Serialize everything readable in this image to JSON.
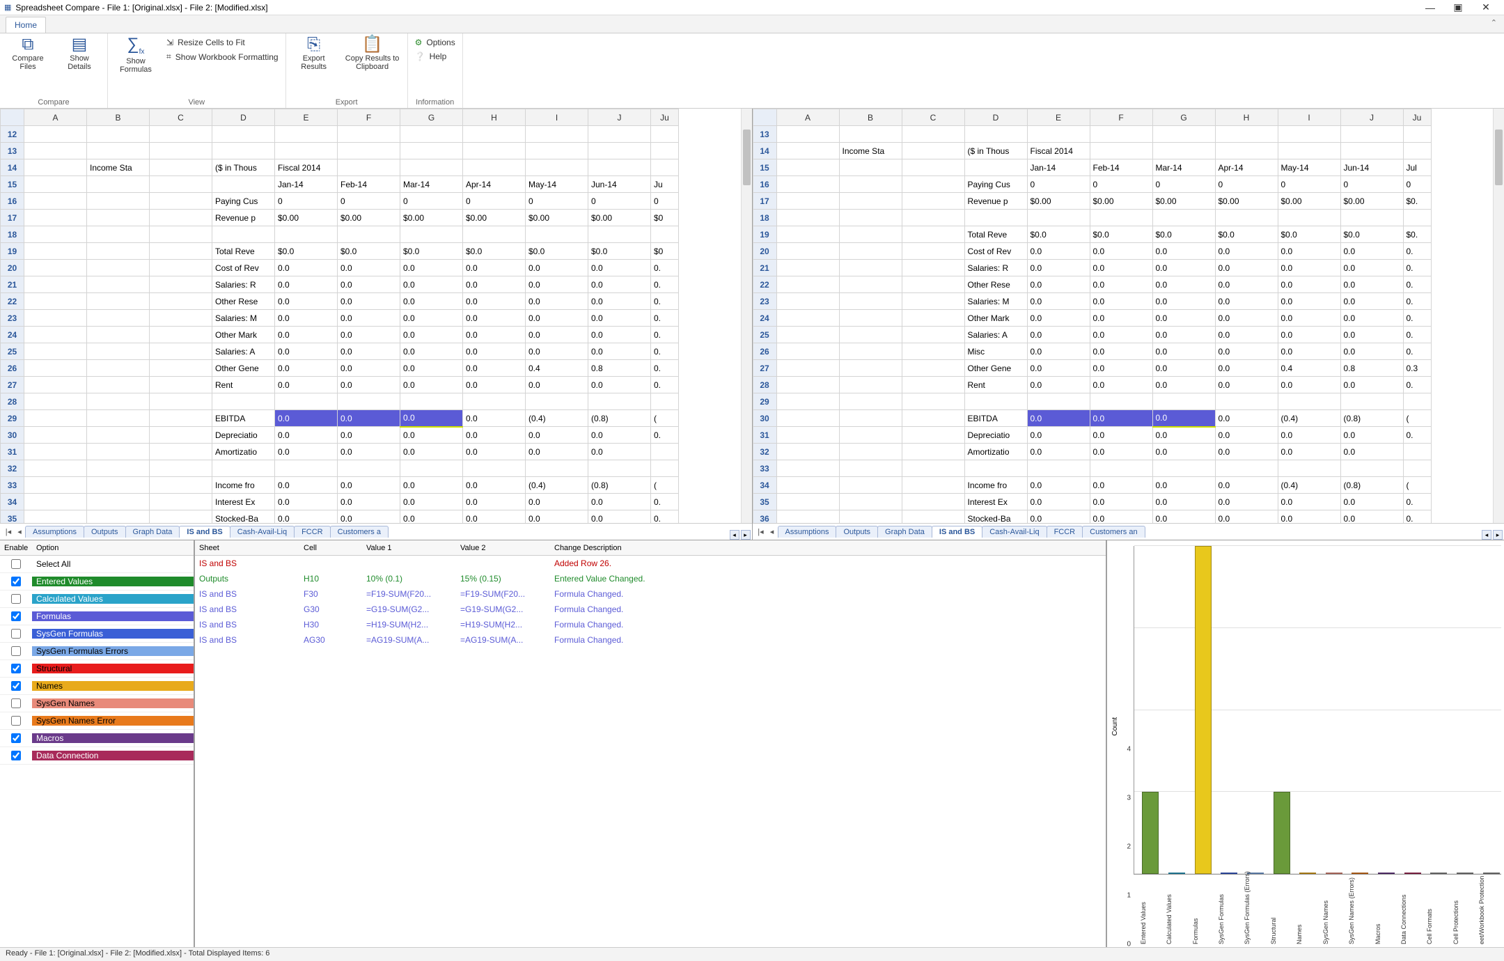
{
  "window": {
    "title": "Spreadsheet Compare - File 1: [Original.xlsx] - File 2: [Modified.xlsx]",
    "min": "—",
    "max": "▣",
    "close": "✕"
  },
  "ribbon": {
    "home_tab": "Home",
    "groups": {
      "compare": {
        "label": "Compare",
        "compare_files": "Compare Files",
        "show_details": "Show Details"
      },
      "view": {
        "label": "View",
        "show_formulas": "Show Formulas",
        "resize": "Resize Cells to Fit",
        "wb_format": "Show Workbook Formatting"
      },
      "export": {
        "label": "Export",
        "export_results": "Export Results",
        "copy_clip": "Copy Results to Clipboard"
      },
      "info": {
        "label": "Information",
        "options": "Options",
        "help": "Help"
      }
    }
  },
  "grid_common": {
    "col_headers": [
      "A",
      "B",
      "C",
      "D",
      "E",
      "F",
      "G",
      "H",
      "I",
      "J",
      "Ju"
    ]
  },
  "grid_left": {
    "row_start": 12,
    "rows": [
      {
        "r": 12,
        "cells": [
          "",
          "",
          "",
          "",
          "",
          "",
          "",
          "",
          "",
          ""
        ]
      },
      {
        "r": 13,
        "cells": [
          "",
          "",
          "",
          "",
          "",
          "",
          "",
          "",
          "",
          ""
        ]
      },
      {
        "r": 14,
        "cells": [
          "",
          "Income Sta",
          "",
          "($ in Thous",
          "Fiscal 2014",
          "",
          "",
          "",
          "",
          ""
        ]
      },
      {
        "r": 15,
        "cells": [
          "",
          "",
          "",
          "",
          "Jan-14",
          "Feb-14",
          "Mar-14",
          "Apr-14",
          "May-14",
          "Jun-14",
          "Ju"
        ]
      },
      {
        "r": 16,
        "cells": [
          "",
          "",
          "",
          "Paying Cus",
          "0",
          "0",
          "0",
          "0",
          "0",
          "0",
          "0"
        ]
      },
      {
        "r": 17,
        "cells": [
          "",
          "",
          "",
          "Revenue p",
          "$0.00",
          "$0.00",
          "$0.00",
          "$0.00",
          "$0.00",
          "$0.00",
          "$0"
        ]
      },
      {
        "r": 18,
        "cells": [
          "",
          "",
          "",
          "",
          "",
          "",
          "",
          "",
          "",
          ""
        ]
      },
      {
        "r": 19,
        "cells": [
          "",
          "",
          "",
          "Total Reve",
          "$0.0",
          "$0.0",
          "$0.0",
          "$0.0",
          "$0.0",
          "$0.0",
          "$0"
        ]
      },
      {
        "r": 20,
        "cells": [
          "",
          "",
          "",
          "Cost of Rev",
          "0.0",
          "0.0",
          "0.0",
          "0.0",
          "0.0",
          "0.0",
          "0."
        ]
      },
      {
        "r": 21,
        "cells": [
          "",
          "",
          "",
          "Salaries: R",
          "0.0",
          "0.0",
          "0.0",
          "0.0",
          "0.0",
          "0.0",
          "0."
        ]
      },
      {
        "r": 22,
        "cells": [
          "",
          "",
          "",
          "Other Rese",
          "0.0",
          "0.0",
          "0.0",
          "0.0",
          "0.0",
          "0.0",
          "0."
        ]
      },
      {
        "r": 23,
        "cells": [
          "",
          "",
          "",
          "Salaries: M",
          "0.0",
          "0.0",
          "0.0",
          "0.0",
          "0.0",
          "0.0",
          "0."
        ]
      },
      {
        "r": 24,
        "cells": [
          "",
          "",
          "",
          "Other Mark",
          "0.0",
          "0.0",
          "0.0",
          "0.0",
          "0.0",
          "0.0",
          "0."
        ]
      },
      {
        "r": 25,
        "cells": [
          "",
          "",
          "",
          "Salaries: A",
          "0.0",
          "0.0",
          "0.0",
          "0.0",
          "0.0",
          "0.0",
          "0."
        ]
      },
      {
        "r": 26,
        "cells": [
          "",
          "",
          "",
          "Other Gene",
          "0.0",
          "0.0",
          "0.0",
          "0.0",
          "0.4",
          "0.8",
          "0."
        ]
      },
      {
        "r": 27,
        "cells": [
          "",
          "",
          "",
          "Rent",
          "0.0",
          "0.0",
          "0.0",
          "0.0",
          "0.0",
          "0.0",
          "0."
        ]
      },
      {
        "r": 28,
        "cells": [
          "",
          "",
          "",
          "",
          "",
          "",
          "",
          "",
          "",
          ""
        ]
      },
      {
        "r": 29,
        "cells": [
          "",
          "",
          "",
          "EBITDA",
          "0.0",
          "0.0",
          "0.0",
          "0.0",
          "(0.4)",
          "(0.8)",
          "("
        ],
        "hl": [
          5,
          6,
          7
        ]
      },
      {
        "r": 30,
        "cells": [
          "",
          "",
          "",
          "Depreciatio",
          "0.0",
          "0.0",
          "0.0",
          "0.0",
          "0.0",
          "0.0",
          "0."
        ]
      },
      {
        "r": 31,
        "cells": [
          "",
          "",
          "",
          "Amortizatio",
          "0.0",
          "0.0",
          "0.0",
          "0.0",
          "0.0",
          "0.0",
          ""
        ]
      },
      {
        "r": 32,
        "cells": [
          "",
          "",
          "",
          "",
          "",
          "",
          "",
          "",
          "",
          ""
        ]
      },
      {
        "r": 33,
        "cells": [
          "",
          "",
          "",
          "Income fro",
          "0.0",
          "0.0",
          "0.0",
          "0.0",
          "(0.4)",
          "(0.8)",
          "("
        ]
      },
      {
        "r": 34,
        "cells": [
          "",
          "",
          "",
          "Interest Ex",
          "0.0",
          "0.0",
          "0.0",
          "0.0",
          "0.0",
          "0.0",
          "0."
        ]
      },
      {
        "r": 35,
        "cells": [
          "",
          "",
          "",
          "Stocked-Ba",
          "0.0",
          "0.0",
          "0.0",
          "0.0",
          "0.0",
          "0.0",
          "0."
        ]
      }
    ],
    "tabs": [
      "Assumptions",
      "Outputs",
      "Graph Data",
      "IS and BS",
      "Cash-Avail-Liq",
      "FCCR",
      "Customers a"
    ],
    "active_tab": "IS and BS"
  },
  "grid_right": {
    "row_start": 13,
    "rows": [
      {
        "r": 13,
        "cells": [
          "",
          "",
          "",
          "",
          "",
          "",
          "",
          "",
          "",
          ""
        ]
      },
      {
        "r": 14,
        "cells": [
          "",
          "Income Sta",
          "",
          "($ in Thous",
          "Fiscal 2014",
          "",
          "",
          "",
          "",
          ""
        ]
      },
      {
        "r": 15,
        "cells": [
          "",
          "",
          "",
          "",
          "Jan-14",
          "Feb-14",
          "Mar-14",
          "Apr-14",
          "May-14",
          "Jun-14",
          "Jul"
        ]
      },
      {
        "r": 16,
        "cells": [
          "",
          "",
          "",
          "Paying Cus",
          "0",
          "0",
          "0",
          "0",
          "0",
          "0",
          "0"
        ]
      },
      {
        "r": 17,
        "cells": [
          "",
          "",
          "",
          "Revenue p",
          "$0.00",
          "$0.00",
          "$0.00",
          "$0.00",
          "$0.00",
          "$0.00",
          "$0."
        ]
      },
      {
        "r": 18,
        "cells": [
          "",
          "",
          "",
          "",
          "",
          "",
          "",
          "",
          "",
          ""
        ]
      },
      {
        "r": 19,
        "cells": [
          "",
          "",
          "",
          "Total Reve",
          "$0.0",
          "$0.0",
          "$0.0",
          "$0.0",
          "$0.0",
          "$0.0",
          "$0."
        ]
      },
      {
        "r": 20,
        "cells": [
          "",
          "",
          "",
          "Cost of Rev",
          "0.0",
          "0.0",
          "0.0",
          "0.0",
          "0.0",
          "0.0",
          "0."
        ]
      },
      {
        "r": 21,
        "cells": [
          "",
          "",
          "",
          "Salaries: R",
          "0.0",
          "0.0",
          "0.0",
          "0.0",
          "0.0",
          "0.0",
          "0."
        ]
      },
      {
        "r": 22,
        "cells": [
          "",
          "",
          "",
          "Other Rese",
          "0.0",
          "0.0",
          "0.0",
          "0.0",
          "0.0",
          "0.0",
          "0."
        ]
      },
      {
        "r": 23,
        "cells": [
          "",
          "",
          "",
          "Salaries: M",
          "0.0",
          "0.0",
          "0.0",
          "0.0",
          "0.0",
          "0.0",
          "0."
        ]
      },
      {
        "r": 24,
        "cells": [
          "",
          "",
          "",
          "Other Mark",
          "0.0",
          "0.0",
          "0.0",
          "0.0",
          "0.0",
          "0.0",
          "0."
        ]
      },
      {
        "r": 25,
        "cells": [
          "",
          "",
          "",
          "Salaries: A",
          "0.0",
          "0.0",
          "0.0",
          "0.0",
          "0.0",
          "0.0",
          "0."
        ]
      },
      {
        "r": 26,
        "cells": [
          "",
          "",
          "",
          "Misc",
          "0.0",
          "0.0",
          "0.0",
          "0.0",
          "0.0",
          "0.0",
          "0."
        ]
      },
      {
        "r": 27,
        "cells": [
          "",
          "",
          "",
          "Other Gene",
          "0.0",
          "0.0",
          "0.0",
          "0.0",
          "0.4",
          "0.8",
          "0.3"
        ]
      },
      {
        "r": 28,
        "cells": [
          "",
          "",
          "",
          "Rent",
          "0.0",
          "0.0",
          "0.0",
          "0.0",
          "0.0",
          "0.0",
          "0."
        ]
      },
      {
        "r": 29,
        "cells": [
          "",
          "",
          "",
          "",
          "",
          "",
          "",
          "",
          "",
          ""
        ]
      },
      {
        "r": 30,
        "cells": [
          "",
          "",
          "",
          "EBITDA",
          "0.0",
          "0.0",
          "0.0",
          "0.0",
          "(0.4)",
          "(0.8)",
          "("
        ],
        "hl": [
          5,
          6,
          7
        ]
      },
      {
        "r": 31,
        "cells": [
          "",
          "",
          "",
          "Depreciatio",
          "0.0",
          "0.0",
          "0.0",
          "0.0",
          "0.0",
          "0.0",
          "0."
        ]
      },
      {
        "r": 32,
        "cells": [
          "",
          "",
          "",
          "Amortizatio",
          "0.0",
          "0.0",
          "0.0",
          "0.0",
          "0.0",
          "0.0",
          ""
        ]
      },
      {
        "r": 33,
        "cells": [
          "",
          "",
          "",
          "",
          "",
          "",
          "",
          "",
          "",
          ""
        ]
      },
      {
        "r": 34,
        "cells": [
          "",
          "",
          "",
          "Income fro",
          "0.0",
          "0.0",
          "0.0",
          "0.0",
          "(0.4)",
          "(0.8)",
          "("
        ]
      },
      {
        "r": 35,
        "cells": [
          "",
          "",
          "",
          "Interest Ex",
          "0.0",
          "0.0",
          "0.0",
          "0.0",
          "0.0",
          "0.0",
          "0."
        ]
      },
      {
        "r": 36,
        "cells": [
          "",
          "",
          "",
          "Stocked-Ba",
          "0.0",
          "0.0",
          "0.0",
          "0.0",
          "0.0",
          "0.0",
          "0."
        ]
      }
    ],
    "tabs": [
      "Assumptions",
      "Outputs",
      "Graph Data",
      "IS and BS",
      "Cash-Avail-Liq",
      "FCCR",
      "Customers an"
    ],
    "active_tab": "IS and BS"
  },
  "options": {
    "head_enable": "Enable",
    "head_option": "Option",
    "rows": [
      {
        "label": "Select All",
        "checked": false,
        "bg": "#ffffff",
        "fg": "#000"
      },
      {
        "label": "Entered Values",
        "checked": true,
        "bg": "#1f8b2b",
        "fg": "#fff"
      },
      {
        "label": "Calculated Values",
        "checked": false,
        "bg": "#2aa3c9",
        "fg": "#fff"
      },
      {
        "label": "Formulas",
        "checked": true,
        "bg": "#5b5bd6",
        "fg": "#fff"
      },
      {
        "label": "SysGen Formulas",
        "checked": false,
        "bg": "#3a5fd6",
        "fg": "#fff"
      },
      {
        "label": "SysGen Formulas Errors",
        "checked": false,
        "bg": "#7aa8e6",
        "fg": "#000"
      },
      {
        "label": "Structural",
        "checked": true,
        "bg": "#e81c1c",
        "fg": "#000"
      },
      {
        "label": "Names",
        "checked": true,
        "bg": "#e8aa1c",
        "fg": "#000"
      },
      {
        "label": "SysGen Names",
        "checked": false,
        "bg": "#e88a7a",
        "fg": "#000"
      },
      {
        "label": "SysGen Names Error",
        "checked": false,
        "bg": "#e87a1c",
        "fg": "#000"
      },
      {
        "label": "Macros",
        "checked": true,
        "bg": "#6a3a8a",
        "fg": "#fff"
      },
      {
        "label": "Data Connection",
        "checked": true,
        "bg": "#a82a5a",
        "fg": "#fff"
      }
    ]
  },
  "diff": {
    "headers": {
      "sheet": "Sheet",
      "cell": "Cell",
      "v1": "Value 1",
      "v2": "Value 2",
      "desc": "Change Description"
    },
    "rows": [
      {
        "sheet": "IS and BS",
        "cell": "",
        "v1": "",
        "v2": "",
        "desc": "Added Row 26.",
        "color": "#c00000"
      },
      {
        "sheet": "Outputs",
        "cell": "H10",
        "v1": "10% (0.1)",
        "v2": "15% (0.15)",
        "desc": "Entered Value Changed.",
        "color": "#1f8b2b"
      },
      {
        "sheet": "IS and BS",
        "cell": "F30",
        "v1": "=F19-SUM(F20...",
        "v2": "=F19-SUM(F20...",
        "desc": "Formula Changed.",
        "color": "#5b5bd6"
      },
      {
        "sheet": "IS and BS",
        "cell": "G30",
        "v1": "=G19-SUM(G2...",
        "v2": "=G19-SUM(G2...",
        "desc": "Formula Changed.",
        "color": "#5b5bd6"
      },
      {
        "sheet": "IS and BS",
        "cell": "H30",
        "v1": "=H19-SUM(H2...",
        "v2": "=H19-SUM(H2...",
        "desc": "Formula Changed.",
        "color": "#5b5bd6"
      },
      {
        "sheet": "IS and BS",
        "cell": "AG30",
        "v1": "=AG19-SUM(A...",
        "v2": "=AG19-SUM(A...",
        "desc": "Formula Changed.",
        "color": "#5b5bd6"
      }
    ]
  },
  "chart_data": {
    "type": "bar",
    "ylabel": "Count",
    "ylim": [
      0,
      4
    ],
    "categories": [
      "Entered Values",
      "Calculated Values",
      "Formulas",
      "SysGen Formulas",
      "SysGen Formulas (Errors)",
      "Structural",
      "Names",
      "SysGen Names",
      "SysGen Names (Errors)",
      "Macros",
      "Data Connections",
      "Cell Formats",
      "Cell Protections",
      "eet/Workbook Protection"
    ],
    "values": [
      1,
      0,
      4,
      0,
      0,
      1,
      0,
      0,
      0,
      0,
      0,
      0,
      0,
      0
    ],
    "colors": [
      "#6a9a3a",
      "#2aa3c9",
      "#e8c81c",
      "#3a5fd6",
      "#7aa8e6",
      "#6a9a3a",
      "#e8aa1c",
      "#e88a7a",
      "#e87a1c",
      "#6a3a8a",
      "#a82a5a",
      "#888",
      "#888",
      "#888"
    ]
  },
  "status": "Ready - File 1: [Original.xlsx] - File 2: [Modified.xlsx] - Total Displayed Items: 6"
}
